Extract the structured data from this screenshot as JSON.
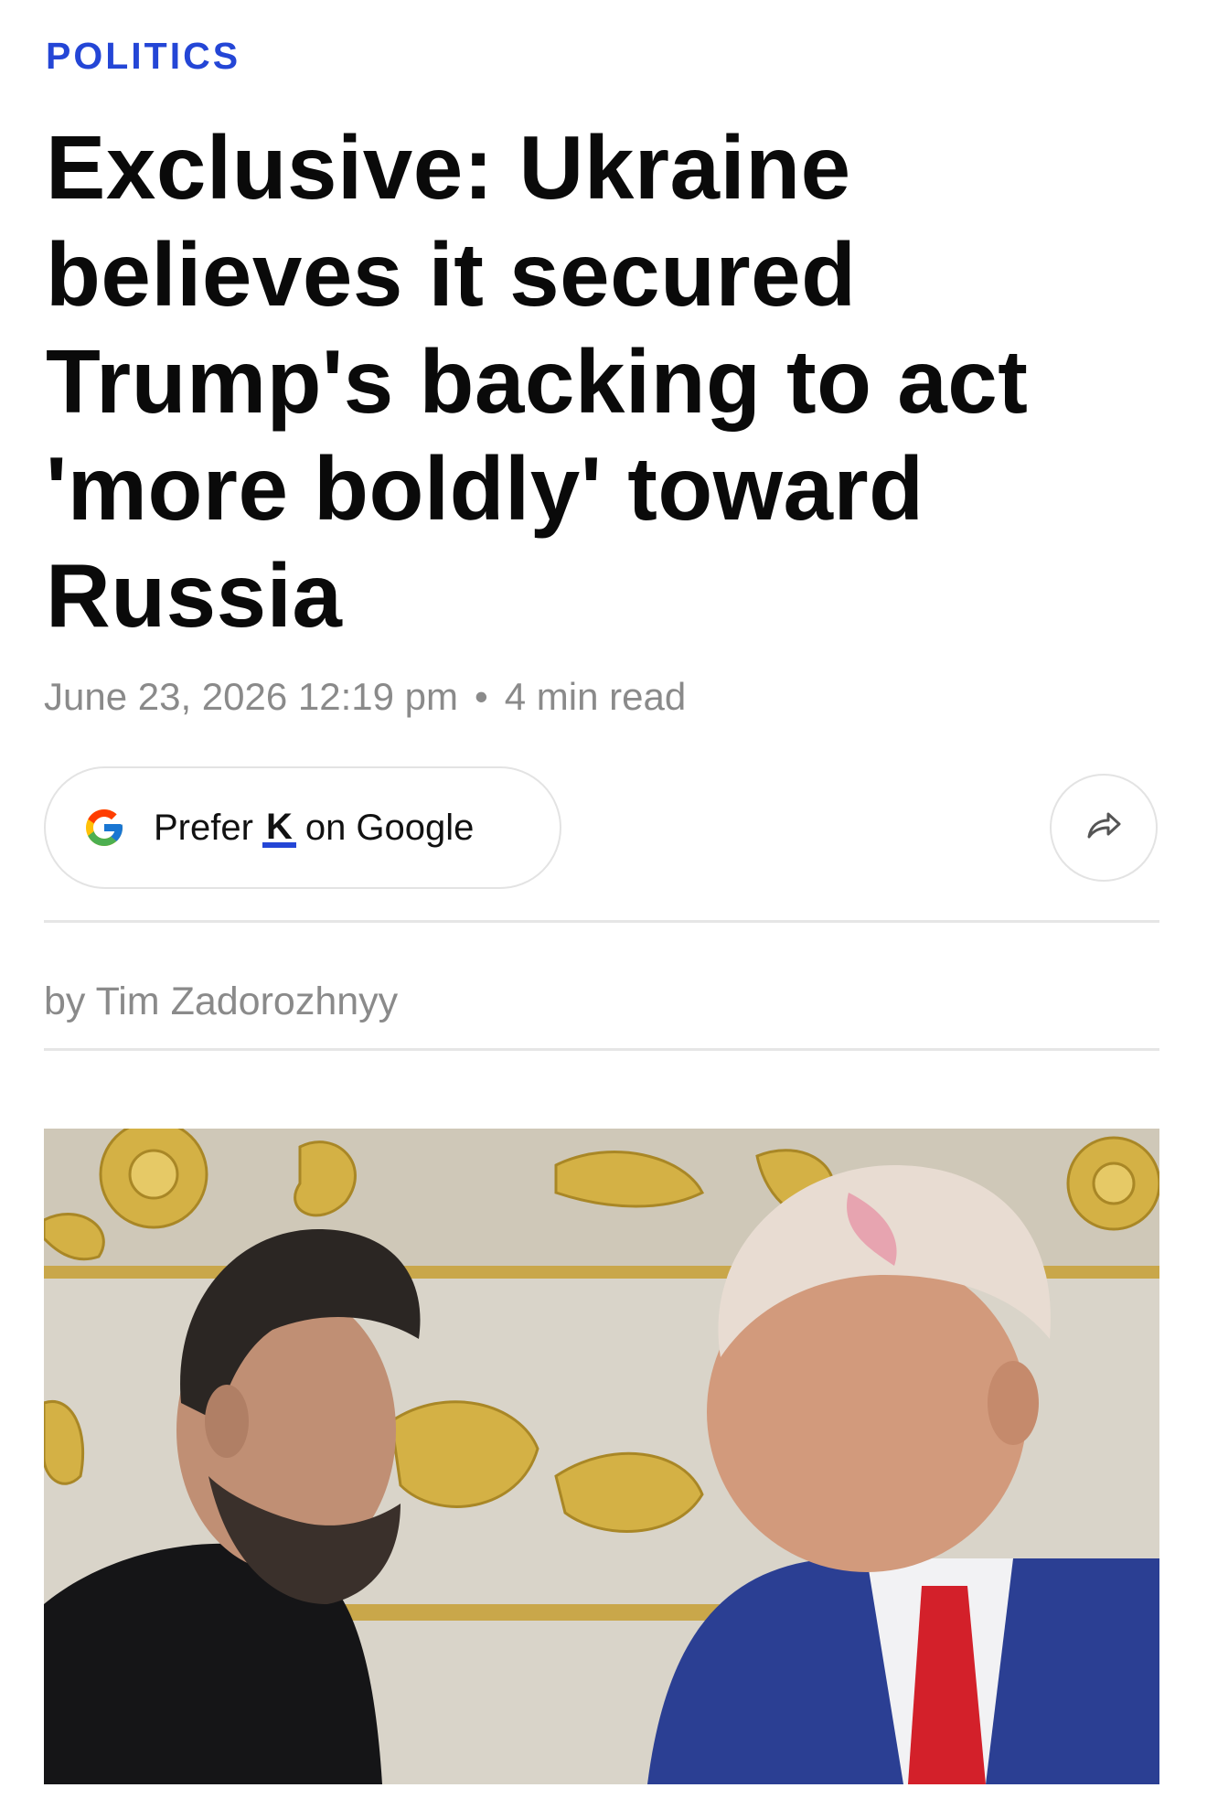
{
  "section": {
    "label": "POLITICS"
  },
  "article": {
    "headline": "Exclusive: Ukraine believes it secured Trump's backing to act 'more boldly' toward Russia",
    "date": "June 23, 2026 12:19 pm",
    "separator": "•",
    "read_time": "4 min read",
    "byline": "by Tim Zadorozhnyy"
  },
  "prefer_button": {
    "prefix": "Prefer",
    "logo_letter": "K",
    "suffix": "on Google"
  },
  "icons": {
    "google": "google-g-icon",
    "share": "share-arrow-icon"
  },
  "colors": {
    "accent": "#2446d6",
    "headline": "#0a0a0a",
    "meta": "#8a8a8a"
  }
}
